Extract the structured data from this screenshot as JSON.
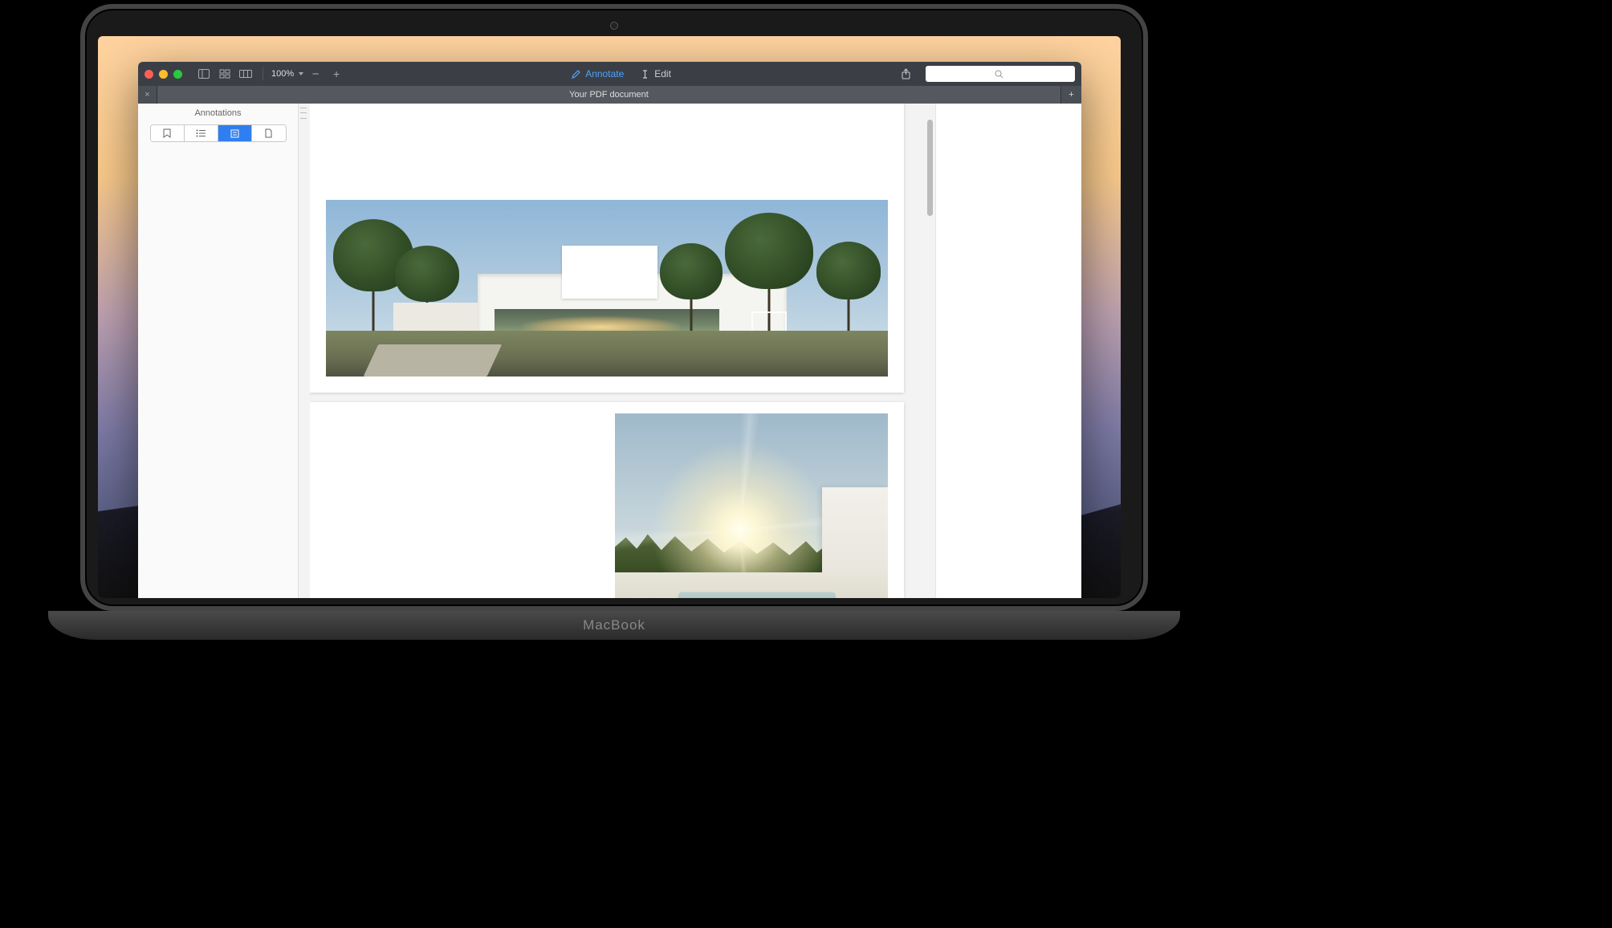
{
  "toolbar": {
    "zoom_label": "100%",
    "annotate_label": "Annotate",
    "edit_label": "Edit"
  },
  "tab": {
    "title": "Your PDF document"
  },
  "sidebar": {
    "title": "Annotations"
  },
  "search": {
    "placeholder": " "
  },
  "device": {
    "brand": "MacBook"
  }
}
